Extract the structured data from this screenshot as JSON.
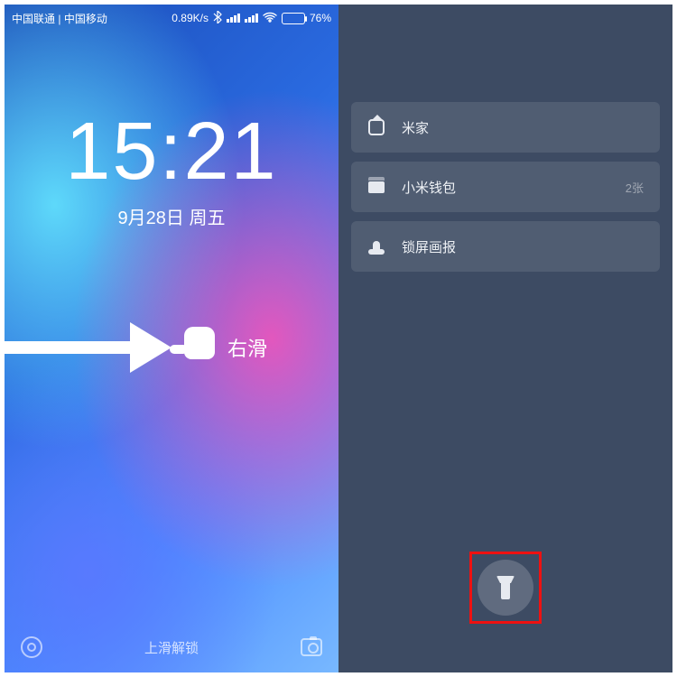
{
  "status": {
    "carrier_left": "中国联通",
    "carrier_divider": " | ",
    "carrier_right": "中国移动",
    "net_speed": "0.89K/s",
    "battery_pct": "76%",
    "battery_fill_width": "76%"
  },
  "lockscreen": {
    "time": "15:21",
    "date": "9月28日 周五",
    "gesture_label": "右滑",
    "unlock_hint": "上滑解锁"
  },
  "neg_one": {
    "cards": [
      {
        "key": "mijia",
        "label": "米家",
        "badge": ""
      },
      {
        "key": "wallet",
        "label": "小米钱包",
        "badge": "2张"
      },
      {
        "key": "lock",
        "label": "锁屏画报",
        "badge": ""
      }
    ]
  }
}
